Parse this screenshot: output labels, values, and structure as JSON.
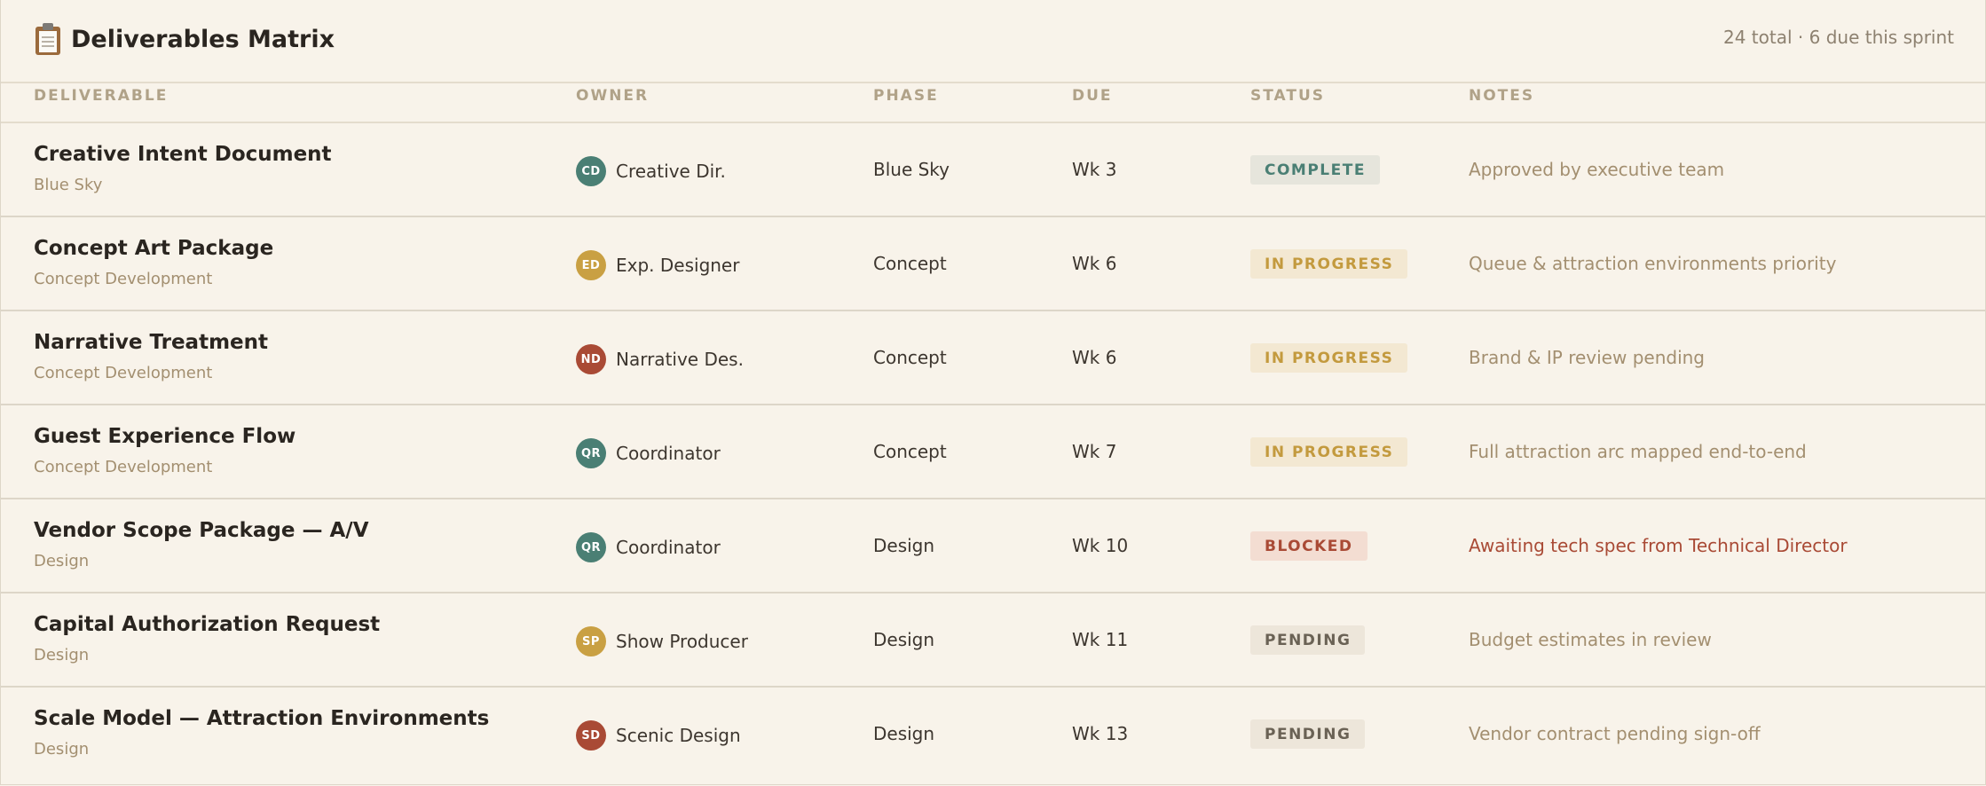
{
  "header": {
    "icon": "clipboard-icon",
    "title": "Deliverables Matrix",
    "summary": "24 total · 6 due this sprint"
  },
  "columns": [
    "DELIVERABLE",
    "OWNER",
    "PHASE",
    "DUE",
    "STATUS",
    "NOTES"
  ],
  "colors": {
    "complete_text": "#4a7f74",
    "complete_bg": "#e6e5dc",
    "inprogress_text": "#c39a3e",
    "inprogress_bg": "#f3e8d2",
    "blocked_text": "#a94a35",
    "blocked_bg": "#f3ddd2",
    "pending_text": "#6a6255",
    "pending_bg": "#ede6da",
    "note_default": "#a38f70",
    "note_alert": "#a94a35"
  },
  "rows": [
    {
      "name": "Creative Intent Document",
      "sub_phase": "Blue Sky",
      "owner_initials": "CD",
      "owner_color": "#4a7f74",
      "owner": "Creative Dir.",
      "phase": "Blue Sky",
      "due": "Wk 3",
      "status": "COMPLETE",
      "status_key": "complete",
      "notes": "Approved by executive team",
      "notes_alert": false
    },
    {
      "name": "Concept Art Package",
      "sub_phase": "Concept Development",
      "owner_initials": "ED",
      "owner_color": "#c9a043",
      "owner": "Exp. Designer",
      "phase": "Concept",
      "due": "Wk 6",
      "status": "IN PROGRESS",
      "status_key": "inprogress",
      "notes": "Queue & attraction environments priority",
      "notes_alert": false
    },
    {
      "name": "Narrative Treatment",
      "sub_phase": "Concept Development",
      "owner_initials": "ND",
      "owner_color": "#a94a35",
      "owner": "Narrative Des.",
      "phase": "Concept",
      "due": "Wk 6",
      "status": "IN PROGRESS",
      "status_key": "inprogress",
      "notes": "Brand & IP review pending",
      "notes_alert": false
    },
    {
      "name": "Guest Experience Flow",
      "sub_phase": "Concept Development",
      "owner_initials": "QR",
      "owner_color": "#4a7f74",
      "owner": "Coordinator",
      "phase": "Concept",
      "due": "Wk 7",
      "status": "IN PROGRESS",
      "status_key": "inprogress",
      "notes": "Full attraction arc mapped end-to-end",
      "notes_alert": false
    },
    {
      "name": "Vendor Scope Package — A/V",
      "sub_phase": "Design",
      "owner_initials": "QR",
      "owner_color": "#4a7f74",
      "owner": "Coordinator",
      "phase": "Design",
      "due": "Wk 10",
      "status": "BLOCKED",
      "status_key": "blocked",
      "notes": "Awaiting tech spec from Technical Director",
      "notes_alert": true
    },
    {
      "name": "Capital Authorization Request",
      "sub_phase": "Design",
      "owner_initials": "SP",
      "owner_color": "#c9a043",
      "owner": "Show Producer",
      "phase": "Design",
      "due": "Wk 11",
      "status": "PENDING",
      "status_key": "pending",
      "notes": "Budget estimates in review",
      "notes_alert": false
    },
    {
      "name": "Scale Model — Attraction Environments",
      "sub_phase": "Design",
      "owner_initials": "SD",
      "owner_color": "#a94a35",
      "owner": "Scenic Design",
      "phase": "Design",
      "due": "Wk 13",
      "status": "PENDING",
      "status_key": "pending",
      "notes": "Vendor contract pending sign-off",
      "notes_alert": false
    }
  ]
}
